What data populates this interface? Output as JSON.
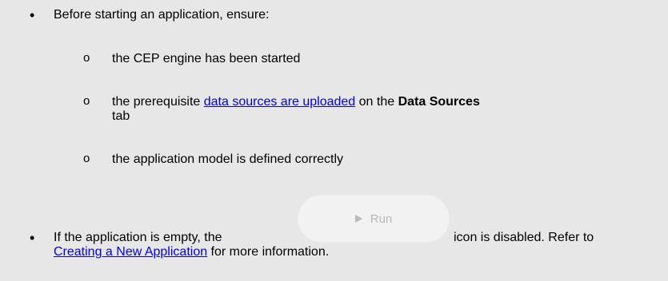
{
  "bullet_1": {
    "marker": "•",
    "text": "Before starting an application, ensure:"
  },
  "sub_items": [
    {
      "marker": "o",
      "text": "the CEP engine has been started"
    },
    {
      "marker": "o",
      "prefix": "the prerequisite ",
      "link": "data sources are uploaded",
      "middle": " on the ",
      "bold": "Data Sources",
      "line2": "tab"
    },
    {
      "marker": "o",
      "text": "the application model is defined correctly"
    }
  ],
  "bullet_2": {
    "marker": "•",
    "prefix": "If the application is empty, the",
    "suffix": "icon is disabled. Refer to",
    "link": "Creating a New Application",
    "line2_suffix": " for more information."
  },
  "run_button": {
    "label": "Run",
    "icon": "play-icon",
    "state": "disabled"
  }
}
